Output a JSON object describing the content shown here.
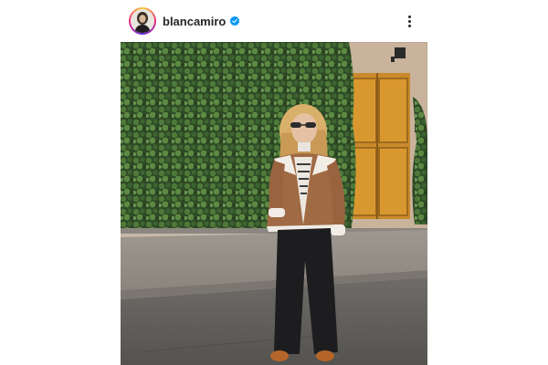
{
  "post": {
    "username": "blancamiro",
    "verified": true,
    "icons": {
      "avatar": "profile-photo-avatar",
      "verified": "verified-badge-icon",
      "more": "more-options-icon"
    },
    "colors": {
      "username": "#262626",
      "verified": "#0095f6",
      "background": "#ffffff"
    }
  }
}
